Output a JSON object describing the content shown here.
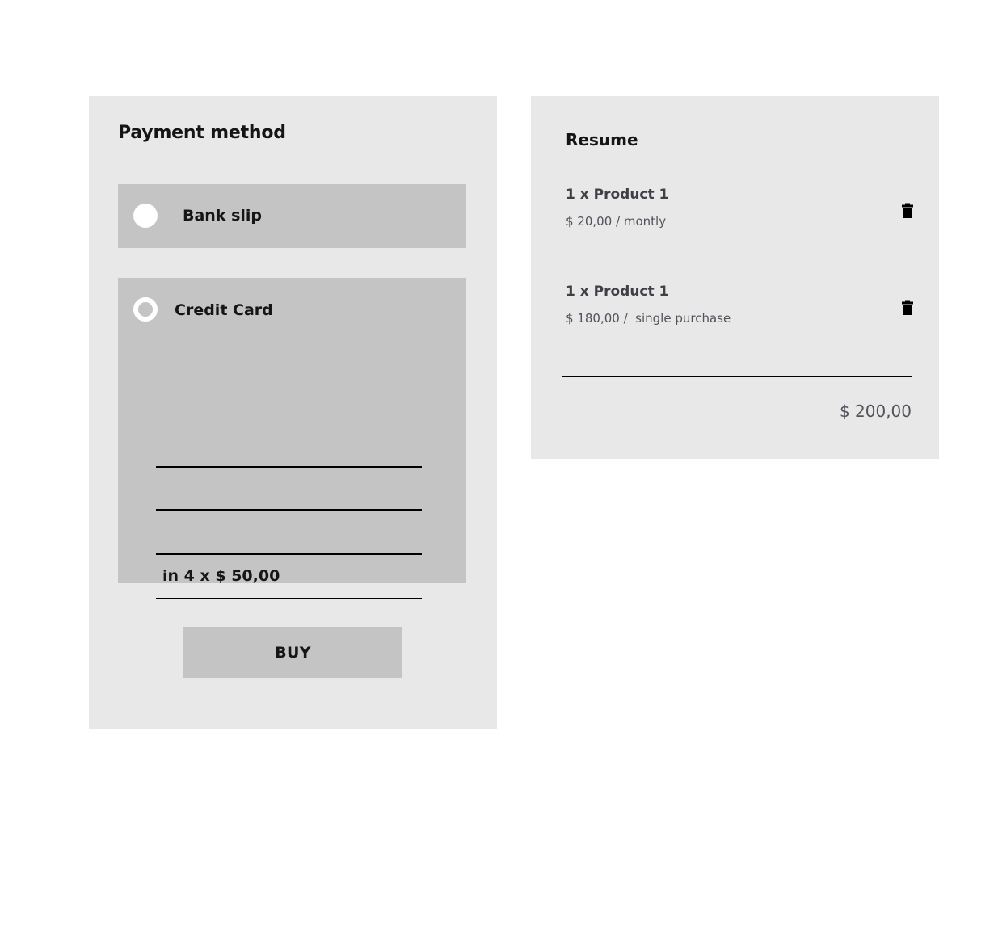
{
  "payment": {
    "title": "Payment method",
    "methods": [
      {
        "id": "bank-slip",
        "label": "Bank slip",
        "selected_marker": "filled-circle"
      },
      {
        "id": "credit-card",
        "label": "Credit Card",
        "selected_marker": "ring-circle"
      }
    ],
    "credit_card_fields": [
      {
        "name": "field-1",
        "value": ""
      },
      {
        "name": "field-2",
        "value": ""
      },
      {
        "name": "field-3",
        "value": ""
      },
      {
        "name": "field-4",
        "value": "in 4 x $ 50,00"
      }
    ],
    "buy_label": "BUY"
  },
  "resume": {
    "title": "Resume",
    "items": [
      {
        "name": "1 x Product 1",
        "price": "$ 20,00 / montly",
        "delete_icon": "trash-icon"
      },
      {
        "name": "1 x Product 1",
        "price": "$ 180,00 /  single purchase",
        "delete_icon": "trash-icon"
      }
    ],
    "total": "$ 200,00"
  },
  "colors": {
    "page_background": "#ffffff",
    "panel_background": "#e9e8e8",
    "box_background": "#c4c4c4",
    "text_primary": "#151515",
    "text_secondary": "#52525b",
    "rule": "#000000",
    "radio": "#ffffff"
  }
}
